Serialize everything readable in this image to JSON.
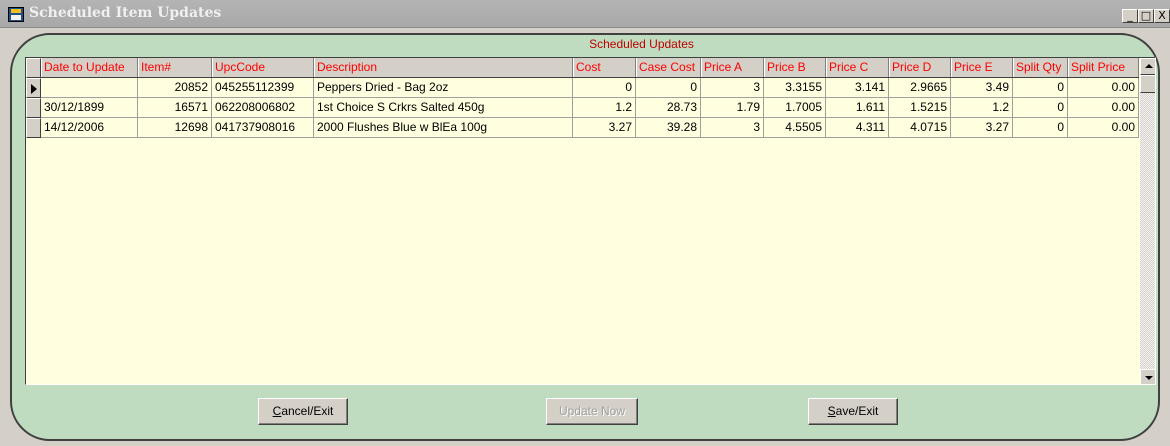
{
  "window": {
    "title": "Scheduled Item Updates",
    "controls": [
      "_",
      "□",
      "X"
    ]
  },
  "grid": {
    "caption": "Scheduled Updates",
    "columns": [
      {
        "key": "date",
        "label": "Date to Update"
      },
      {
        "key": "item",
        "label": "Item#"
      },
      {
        "key": "upc",
        "label": "UpcCode"
      },
      {
        "key": "desc",
        "label": "Description"
      },
      {
        "key": "cost",
        "label": "Cost"
      },
      {
        "key": "case_cost",
        "label": "Case Cost"
      },
      {
        "key": "price_a",
        "label": "Price A"
      },
      {
        "key": "price_b",
        "label": "Price B"
      },
      {
        "key": "price_c",
        "label": "Price C"
      },
      {
        "key": "price_d",
        "label": "Price D"
      },
      {
        "key": "price_e",
        "label": "Price E"
      },
      {
        "key": "split_qty",
        "label": "Split Qty"
      },
      {
        "key": "split_price",
        "label": "Split Price"
      }
    ],
    "rows": [
      {
        "cells": [
          "",
          "20852",
          "045255112399",
          " Peppers Dried - Bag 2oz",
          "0",
          "0",
          "3",
          "3.3155",
          "3.141",
          "2.9665",
          "3.49",
          "0",
          "0.00"
        ]
      },
      {
        "cells": [
          "30/12/1899",
          "16571",
          "062208006802",
          "1st Choice S Crkrs Salted 450g",
          "1.2",
          "28.73",
          "1.79",
          "1.7005",
          "1.611",
          "1.5215",
          "1.2",
          "0",
          "0.00"
        ]
      },
      {
        "cells": [
          "14/12/2006",
          "12698",
          "041737908016",
          "2000 Flushes Blue w BlEa 100g",
          "3.27",
          "39.28",
          "3",
          "4.5505",
          "4.311",
          "4.0715",
          "3.27",
          "0",
          "0.00"
        ]
      }
    ],
    "current_row": 0
  },
  "buttons": {
    "cancel": {
      "accel": "C",
      "rest": "ancel/Exit"
    },
    "update": {
      "label": "Update Now",
      "disabled": true
    },
    "save": {
      "accel": "S",
      "rest": "ave/Exit"
    }
  }
}
